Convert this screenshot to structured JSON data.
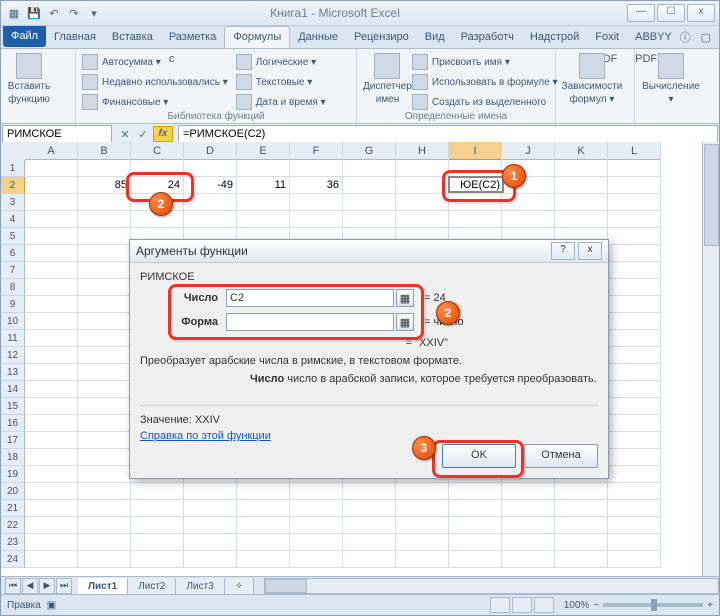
{
  "title": "Книга1 - Microsoft Excel",
  "qat": {
    "save": "💾",
    "undo": "↶",
    "redo": "↷"
  },
  "win": {
    "min": "—",
    "max": "☐",
    "close": "x"
  },
  "tabs": {
    "file": "Файл",
    "items": [
      "Главная",
      "Вставка",
      "Разметка с",
      "Формулы",
      "Данные",
      "Рецензиро",
      "Вид",
      "Разработч",
      "Надстрой",
      "Foxit PDF",
      "ABBYY PDF"
    ]
  },
  "ribbon": {
    "insert_fn_top": "Вставить",
    "insert_fn_bottom": "функцию",
    "group1_label": "Библиотека функций",
    "col1": [
      "Автосумма ▾",
      "Недавно использовались ▾",
      "Финансовые ▾"
    ],
    "col2": [
      "Логические ▾",
      "Текстовые ▾",
      "Дата и время ▾"
    ],
    "name_mgr_top": "Диспетчер",
    "name_mgr_bottom": "имен",
    "group2_label": "Определенные имена",
    "col3": [
      "Присвоить имя ▾",
      "Использовать в формуле ▾",
      "Создать из выделенного"
    ],
    "dep_top": "Зависимости",
    "dep_bottom": "формул ▾",
    "calc": "Вычисление",
    "calc2": "▾"
  },
  "namebox": "РИМСКОЕ",
  "fb": {
    "cancel": "✕",
    "enter": "✓",
    "fx": "fx"
  },
  "formula": "=РИМСКОЕ(C2)",
  "columns": [
    "A",
    "B",
    "C",
    "D",
    "E",
    "F",
    "G",
    "H",
    "I",
    "J",
    "K",
    "L"
  ],
  "row_values": {
    "B2": "85",
    "C2": "24",
    "D2": "-49",
    "E2": "11",
    "F2": "36"
  },
  "active_cell_display": "ЮЕ(C2)",
  "dialog": {
    "title": "Аргументы функции",
    "fname": "РИМСКОЕ",
    "arg1_label": "Число",
    "arg1_value": "C2",
    "arg1_result": "= 24",
    "arg2_label": "Форма",
    "arg2_value": "",
    "arg2_result": "= число",
    "preview_eq": "= ",
    "preview_val": "\"XXIV\"",
    "desc": "Преобразует арабские числа в римские, в текстовом формате.",
    "arg_desc_label": "Число",
    "arg_desc": "  число в арабской записи, которое требуется преобразовать.",
    "value_label": "Значение:  ",
    "value": "XXIV",
    "help": "Справка по этой функции",
    "ok": "OK",
    "cancel": "Отмена"
  },
  "badges": {
    "b1": "1",
    "b2": "2",
    "b2b": "2",
    "b3": "3"
  },
  "sheets": [
    "Лист1",
    "Лист2",
    "Лист3"
  ],
  "status": {
    "mode": "Правка",
    "zoom": "100%"
  }
}
